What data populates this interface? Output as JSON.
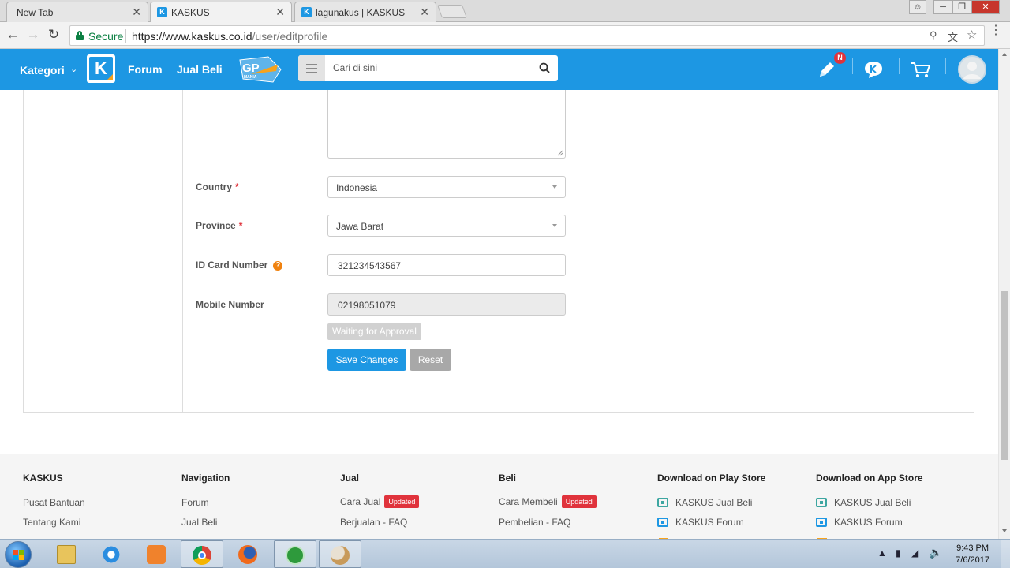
{
  "browser": {
    "tabs": [
      {
        "title": "New Tab"
      },
      {
        "title": "KASKUS"
      },
      {
        "title": "lagunakus | KASKUS"
      }
    ],
    "secure_label": "Secure",
    "url_host": "https://www.kaskus.co.id",
    "url_path": "/user/editprofile"
  },
  "header": {
    "kategori": "Kategori",
    "logo_letter": "K",
    "nav": [
      "Forum",
      "Jual Beli"
    ],
    "gp_text": "GP",
    "gp_sub": "MANIA",
    "search_placeholder": "Cari di sini",
    "notif_badge": "N",
    "accent": "#1d97e3"
  },
  "form": {
    "country": {
      "label": "Country",
      "value": "Indonesia"
    },
    "province": {
      "label": "Province",
      "value": "Jawa Barat"
    },
    "id_card": {
      "label": "ID Card Number",
      "value": "321234543567",
      "help": "?"
    },
    "mobile": {
      "label": "Mobile Number",
      "value": "02198051079"
    },
    "required_marker": "*",
    "waiting_badge": "Waiting for Approval",
    "save_button": "Save Changes",
    "reset_button": "Reset"
  },
  "footer": {
    "columns": [
      {
        "heading": "KASKUS",
        "links": [
          "Pusat Bantuan",
          "Tentang Kami"
        ]
      },
      {
        "heading": "Navigation",
        "links": [
          "Forum",
          "Jual Beli"
        ]
      },
      {
        "heading": "Jual",
        "links": [
          "Cara Jual",
          "Berjualan - FAQ"
        ]
      },
      {
        "heading": "Beli",
        "links": [
          "Cara Membeli",
          "Pembelian - FAQ"
        ]
      },
      {
        "heading": "Download on Play Store",
        "links": [
          "KASKUS Jual Beli",
          "KASKUS Forum"
        ]
      },
      {
        "heading": "Download on App Store",
        "links": [
          "KASKUS Jual Beli",
          "KASKUS Forum"
        ]
      }
    ],
    "updated_badge": "Updated"
  },
  "taskbar": {
    "time": "9:43 PM",
    "date": "7/6/2017"
  }
}
